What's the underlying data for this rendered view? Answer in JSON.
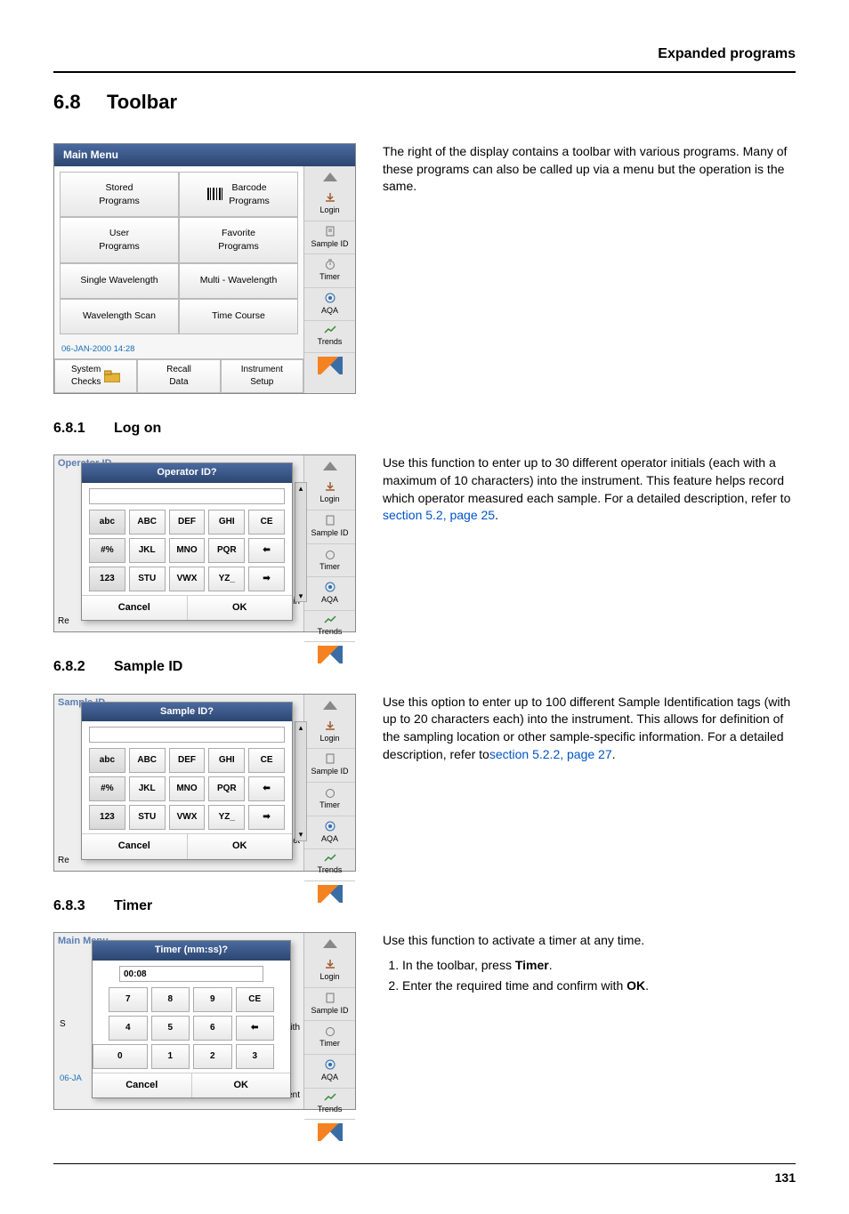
{
  "header": {
    "category": "Expanded programs"
  },
  "section": {
    "num": "6.8",
    "title": "Toolbar"
  },
  "sub1": {
    "num": "6.8.1",
    "title": "Log on"
  },
  "sub2": {
    "num": "6.8.2",
    "title": "Sample ID"
  },
  "sub3": {
    "num": "6.8.3",
    "title": "Timer"
  },
  "page": "131",
  "toolbar_text": "The right of the display contains a toolbar with various programs. Many of these programs can also be called up via a menu but the operation is the same.",
  "logon_text_prefix": "Use this function to enter up to 30 different operator initials (each with a maximum of 10 characters) into the instrument. This feature helps record which operator measured each sample. For a detailed description, refer to ",
  "logon_link": "section 5.2, page 25",
  "dot": ".",
  "sample_text_prefix": "Use this option to enter up to 100 different Sample Identification tags (with up to 20 characters each) into the instrument. This allows for  definition of the sampling location or other sample-specific information. For a detailed description, refer to",
  "sample_link": "section 5.2.2, page 27",
  "timer_text": "Use this function to activate a timer at any time.",
  "timer_step1_pre": "In the toolbar, press ",
  "timer_step1_bold": "Timer",
  "timer_step2_pre": "Enter the required time and confirm with ",
  "timer_step2_bold": "OK",
  "mainmenu": {
    "title": "Main Menu",
    "cells": {
      "stored": "Stored\nPrograms",
      "barcode": "Barcode\nPrograms",
      "user": "User\nPrograms",
      "favorite": "Favorite\nPrograms",
      "single": "Single Wavelength",
      "multi": "Multi - Wavelength",
      "scan": "Wavelength Scan",
      "time": "Time Course"
    },
    "date": "06-JAN-2000  14:28",
    "bottom": {
      "system": "System\nChecks",
      "recall": "Recall\nData",
      "instrument": "Instrument\nSetup"
    }
  },
  "sidebar": {
    "login": "Login",
    "sample": "Sample ID",
    "timer": "Timer",
    "aqa": "AQA",
    "trends": "Trends"
  },
  "op_dialog": {
    "bg_title": "Operator ID",
    "title": "Operator ID?",
    "row1": [
      "abc",
      "ABC",
      "DEF",
      "GHI",
      "CE"
    ],
    "row2": [
      "#%",
      "JKL",
      "MNO",
      "PQR",
      "⬅"
    ],
    "row3": [
      "123",
      "STU",
      "VWX",
      "YZ_",
      "➡"
    ],
    "cancel": "Cancel",
    "ok": "OK",
    "bg_bottom": "Re",
    "bg_right": "gin"
  },
  "samp_dialog": {
    "bg_title": "Sample ID",
    "title": "Sample ID?",
    "row1": [
      "abc",
      "ABC",
      "DEF",
      "GHI",
      "CE"
    ],
    "row2": [
      "#%",
      "JKL",
      "MNO",
      "PQR",
      "⬅"
    ],
    "row3": [
      "123",
      "STU",
      "VWX",
      "YZ_",
      "➡"
    ],
    "cancel": "Cancel",
    "ok": "OK",
    "bg_bottom": "Re",
    "bg_right": "ect"
  },
  "timer_dialog": {
    "bg_title": "Main Menu",
    "title": "Timer (mm:ss)?",
    "value": "00:08",
    "row1": [
      "7",
      "8",
      "9",
      "CE"
    ],
    "row2": [
      "4",
      "5",
      "6",
      "⬅"
    ],
    "row3": [
      "0",
      "1",
      "2",
      "3"
    ],
    "cancel": "Cancel",
    "ok": "OK",
    "bg_left1": "S",
    "bg_left2": "",
    "bg_date": "06-JA",
    "bg_right_mid": "ith",
    "bg_right_bot": "ent"
  }
}
